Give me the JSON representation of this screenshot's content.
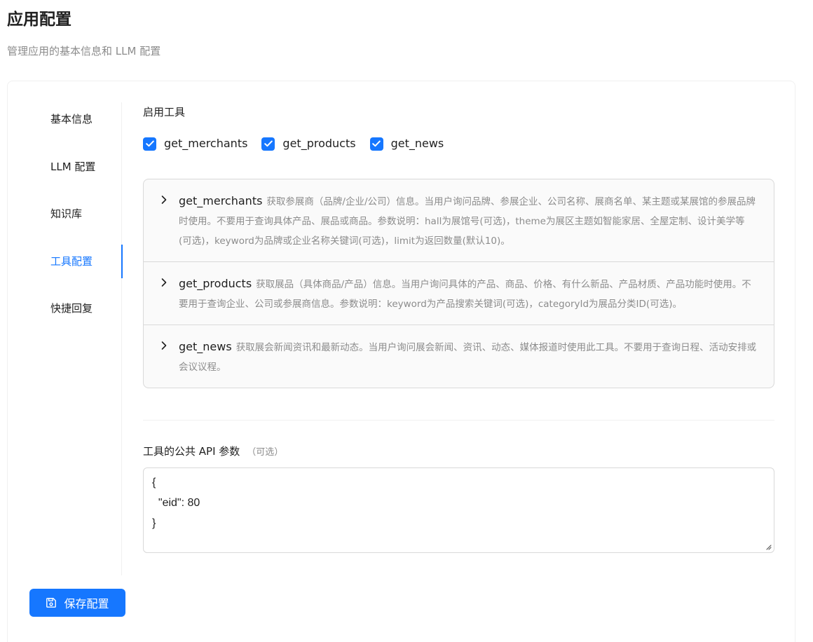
{
  "header": {
    "title": "应用配置",
    "subtitle": "管理应用的基本信息和 LLM 配置"
  },
  "sidebar": {
    "items": [
      {
        "label": "基本信息",
        "active": false
      },
      {
        "label": "LLM 配置",
        "active": false
      },
      {
        "label": "知识库",
        "active": false
      },
      {
        "label": "工具配置",
        "active": true
      },
      {
        "label": "快捷回复",
        "active": false
      }
    ]
  },
  "tools": {
    "section_label": "启用工具",
    "enabled": [
      {
        "label": "get_merchants",
        "checked": true
      },
      {
        "label": "get_products",
        "checked": true
      },
      {
        "label": "get_news",
        "checked": true
      }
    ],
    "details": [
      {
        "name": "get_merchants",
        "description": "获取参展商（品牌/企业/公司）信息。当用户询问品牌、参展企业、公司名称、展商名单、某主题或某展馆的参展品牌时使用。不要用于查询具体产品、展品或商品。参数说明：hall为展馆号(可选)，theme为展区主题如智能家居、全屋定制、设计美学等(可选)，keyword为品牌或企业名称关键词(可选)，limit为返回数量(默认10)。"
      },
      {
        "name": "get_products",
        "description": "获取展品（具体商品/产品）信息。当用户询问具体的产品、商品、价格、有什么新品、产品材质、产品功能时使用。不要用于查询企业、公司或参展商信息。参数说明：keyword为产品搜索关键词(可选)，categoryId为展品分类ID(可选)。"
      },
      {
        "name": "get_news",
        "description": "获取展会新闻资讯和最新动态。当用户询问展会新闻、资讯、动态、媒体报道时使用此工具。不要用于查询日程、活动安排或会议议程。"
      }
    ]
  },
  "api_params": {
    "label": "工具的公共 API 参数",
    "optional_note": "（可选）",
    "value": "{\n  \"eid\": 80\n}"
  },
  "actions": {
    "save_label": "保存配置"
  },
  "colors": {
    "primary": "#1677ff",
    "border": "#d9d9d9",
    "muted_text": "#8c8c8c"
  },
  "icons": {
    "checkbox": "check-icon",
    "collapse": "chevron-right-icon",
    "save": "save-icon"
  }
}
